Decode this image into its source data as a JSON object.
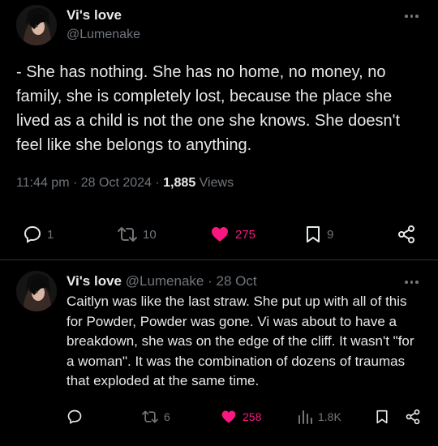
{
  "main_tweet": {
    "display_name": "Vi's love",
    "handle": "@Lumenake",
    "text": "- She has nothing. She has no home, no money, no family, she is completely lost, because the place she lived as a child is not the one she knows. She doesn't feel like she belongs to anything.",
    "time": "11:44 pm",
    "date": "28 Oct 2024",
    "views_count": "1,885",
    "views_label": "Views",
    "replies": "1",
    "reposts": "10",
    "likes": "275",
    "bookmarks": "9"
  },
  "reply_tweet": {
    "display_name": "Vi's love",
    "handle": "@Lumenake",
    "date": "28 Oct",
    "text": "Caitlyn was like the last straw. She put up with all of this for Powder, Powder was gone. Vi was about to have a breakdown, she was on the edge of the cliff. It wasn't \"for a woman\". It was the combination of dozens of traumas that exploded at the same time.",
    "reposts": "6",
    "likes": "258",
    "views": "1.8K"
  },
  "colors": {
    "background": "#000000",
    "text": "#e7e9ea",
    "muted": "#71767b",
    "like": "#f91880",
    "divider": "#2f3336"
  },
  "icons": [
    "avatar",
    "more-icon",
    "reply-icon",
    "repost-icon",
    "heart-icon",
    "bookmark-icon",
    "share-icon",
    "views-icon"
  ]
}
